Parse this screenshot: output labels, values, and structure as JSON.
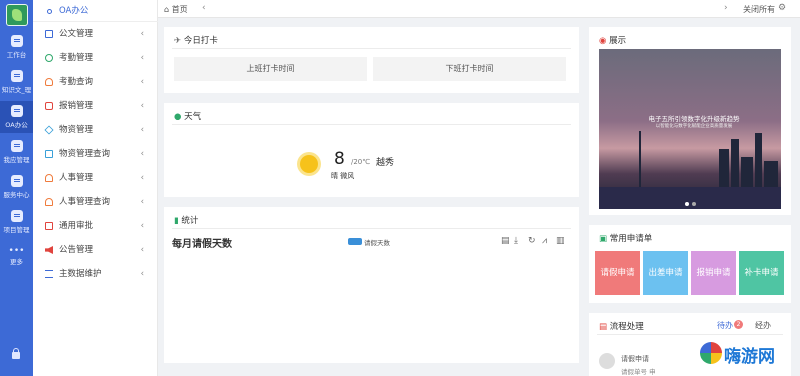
{
  "rail": {
    "items": [
      {
        "label": "工作台",
        "icon": "workbench-icon"
      },
      {
        "label": "知识文_理",
        "icon": "knowledge-icon"
      },
      {
        "label": "OA办公",
        "icon": "oa-icon",
        "active": true
      },
      {
        "label": "我应管理",
        "icon": "manage-icon"
      },
      {
        "label": "服务中心",
        "icon": "service-icon"
      },
      {
        "label": "项目管理",
        "icon": "project-icon"
      },
      {
        "label": "更多",
        "icon": "more-icon"
      }
    ]
  },
  "menu": {
    "items": [
      {
        "label": "OA办公",
        "icon": "dot-icon",
        "selected": true
      },
      {
        "label": "公文管理",
        "icon": "doc-icon",
        "color": "#3d6ad6"
      },
      {
        "label": "考勤管理",
        "icon": "clock-icon",
        "color": "#2fa86b"
      },
      {
        "label": "考勤查询",
        "icon": "user-search-icon",
        "color": "#ef7b3c"
      },
      {
        "label": "报销管理",
        "icon": "money-icon",
        "color": "#e0443e"
      },
      {
        "label": "物资管理",
        "icon": "box-icon",
        "color": "#3aa0d8"
      },
      {
        "label": "物资管理查询",
        "icon": "box-search-icon",
        "color": "#3aa0d8"
      },
      {
        "label": "人事管理",
        "icon": "person-icon",
        "color": "#ef7b3c"
      },
      {
        "label": "人事管理查询",
        "icon": "person-search-icon",
        "color": "#ef7b3c"
      },
      {
        "label": "通用审批",
        "icon": "approve-icon",
        "color": "#e0443e"
      },
      {
        "label": "公告管理",
        "icon": "notice-icon",
        "color": "#e0443e"
      },
      {
        "label": "主数据维护",
        "icon": "data-icon",
        "color": "#3d6ad6"
      }
    ]
  },
  "topbar": {
    "home": "首页",
    "close_all": "关闭所有"
  },
  "clock": {
    "title": "今日打卡",
    "in": "上班打卡时间",
    "out": "下班打卡时间"
  },
  "weather": {
    "title": "天气",
    "temp": "8",
    "range": "/20℃",
    "city": "越秀",
    "desc": "晴 微风"
  },
  "stats": {
    "title": "统计",
    "chart_title": "每月请假天数",
    "legend": "请假天数",
    "legend_color": "#3a8fd8"
  },
  "showcase": {
    "title": "展示",
    "headline": "电子五所引领数字化升级新趋势",
    "sub": "以智能化与数字化赋能企业高质量发展"
  },
  "apps": {
    "title": "常用申请单",
    "items": [
      {
        "label": "请假申请",
        "color": "#f07a7a"
      },
      {
        "label": "出差申请",
        "color": "#6cc1f0"
      },
      {
        "label": "报销申请",
        "color": "#d79be0"
      },
      {
        "label": "补卡申请",
        "color": "#4fc5a3"
      }
    ]
  },
  "flow": {
    "title": "流程处理",
    "todo": "待办",
    "todo_count": "2",
    "done": "经办",
    "item": "请假申请",
    "item_sub": "请假单号 申"
  },
  "watermark": {
    "text": "嗨游网"
  }
}
